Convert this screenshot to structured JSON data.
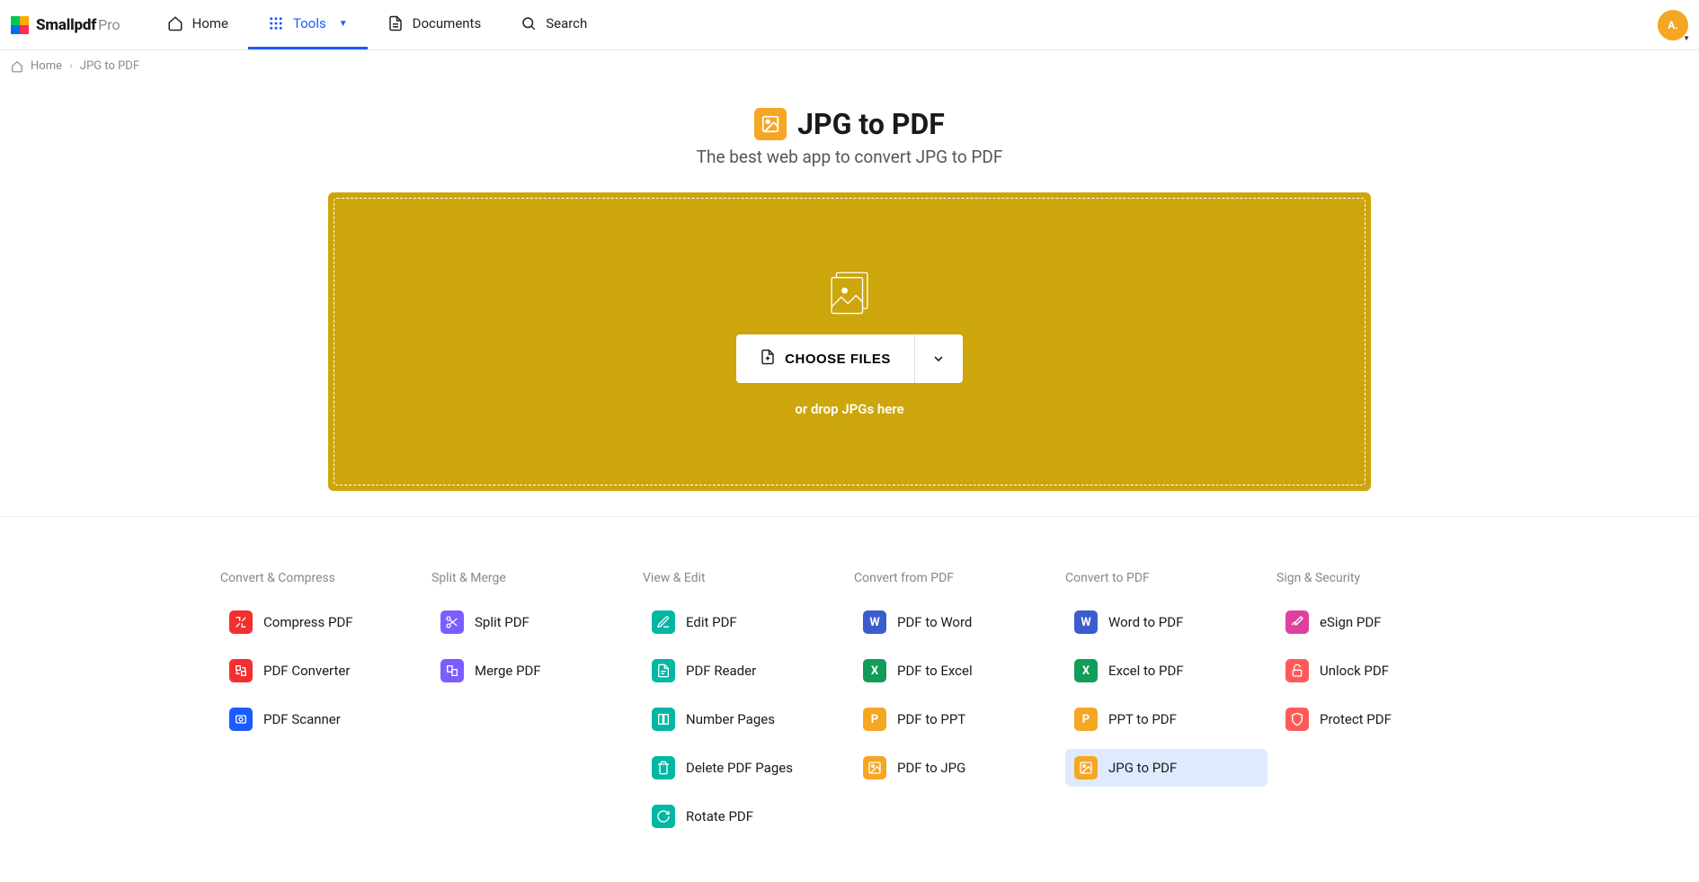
{
  "brand": {
    "name": "Smallpdf",
    "suffix": "Pro"
  },
  "nav": {
    "home": "Home",
    "tools": "Tools",
    "documents": "Documents",
    "search": "Search"
  },
  "avatar": {
    "initials": "A."
  },
  "breadcrumb": {
    "home": "Home",
    "current": "JPG to PDF"
  },
  "hero": {
    "title": "JPG to PDF",
    "subtitle": "The best web app to convert JPG to PDF"
  },
  "dropzone": {
    "button": "CHOOSE FILES",
    "hint": "or drop JPGs here"
  },
  "toolCategories": {
    "c0": "Convert & Compress",
    "c1": "Split & Merge",
    "c2": "View & Edit",
    "c3": "Convert from PDF",
    "c4": "Convert to PDF",
    "c5": "Sign & Security"
  },
  "tools": {
    "compress": "Compress PDF",
    "converter": "PDF Converter",
    "scanner": "PDF Scanner",
    "split": "Split PDF",
    "merge": "Merge PDF",
    "edit": "Edit PDF",
    "reader": "PDF Reader",
    "number": "Number Pages",
    "delete": "Delete PDF Pages",
    "rotate": "Rotate PDF",
    "toWord": "PDF to Word",
    "toExcel": "PDF to Excel",
    "toPPT": "PDF to PPT",
    "toJPG": "PDF to JPG",
    "wordTo": "Word to PDF",
    "excelTo": "Excel to PDF",
    "pptTo": "PPT to PDF",
    "jpgTo": "JPG to PDF",
    "esign": "eSign PDF",
    "unlock": "Unlock PDF",
    "protect": "Protect PDF"
  }
}
